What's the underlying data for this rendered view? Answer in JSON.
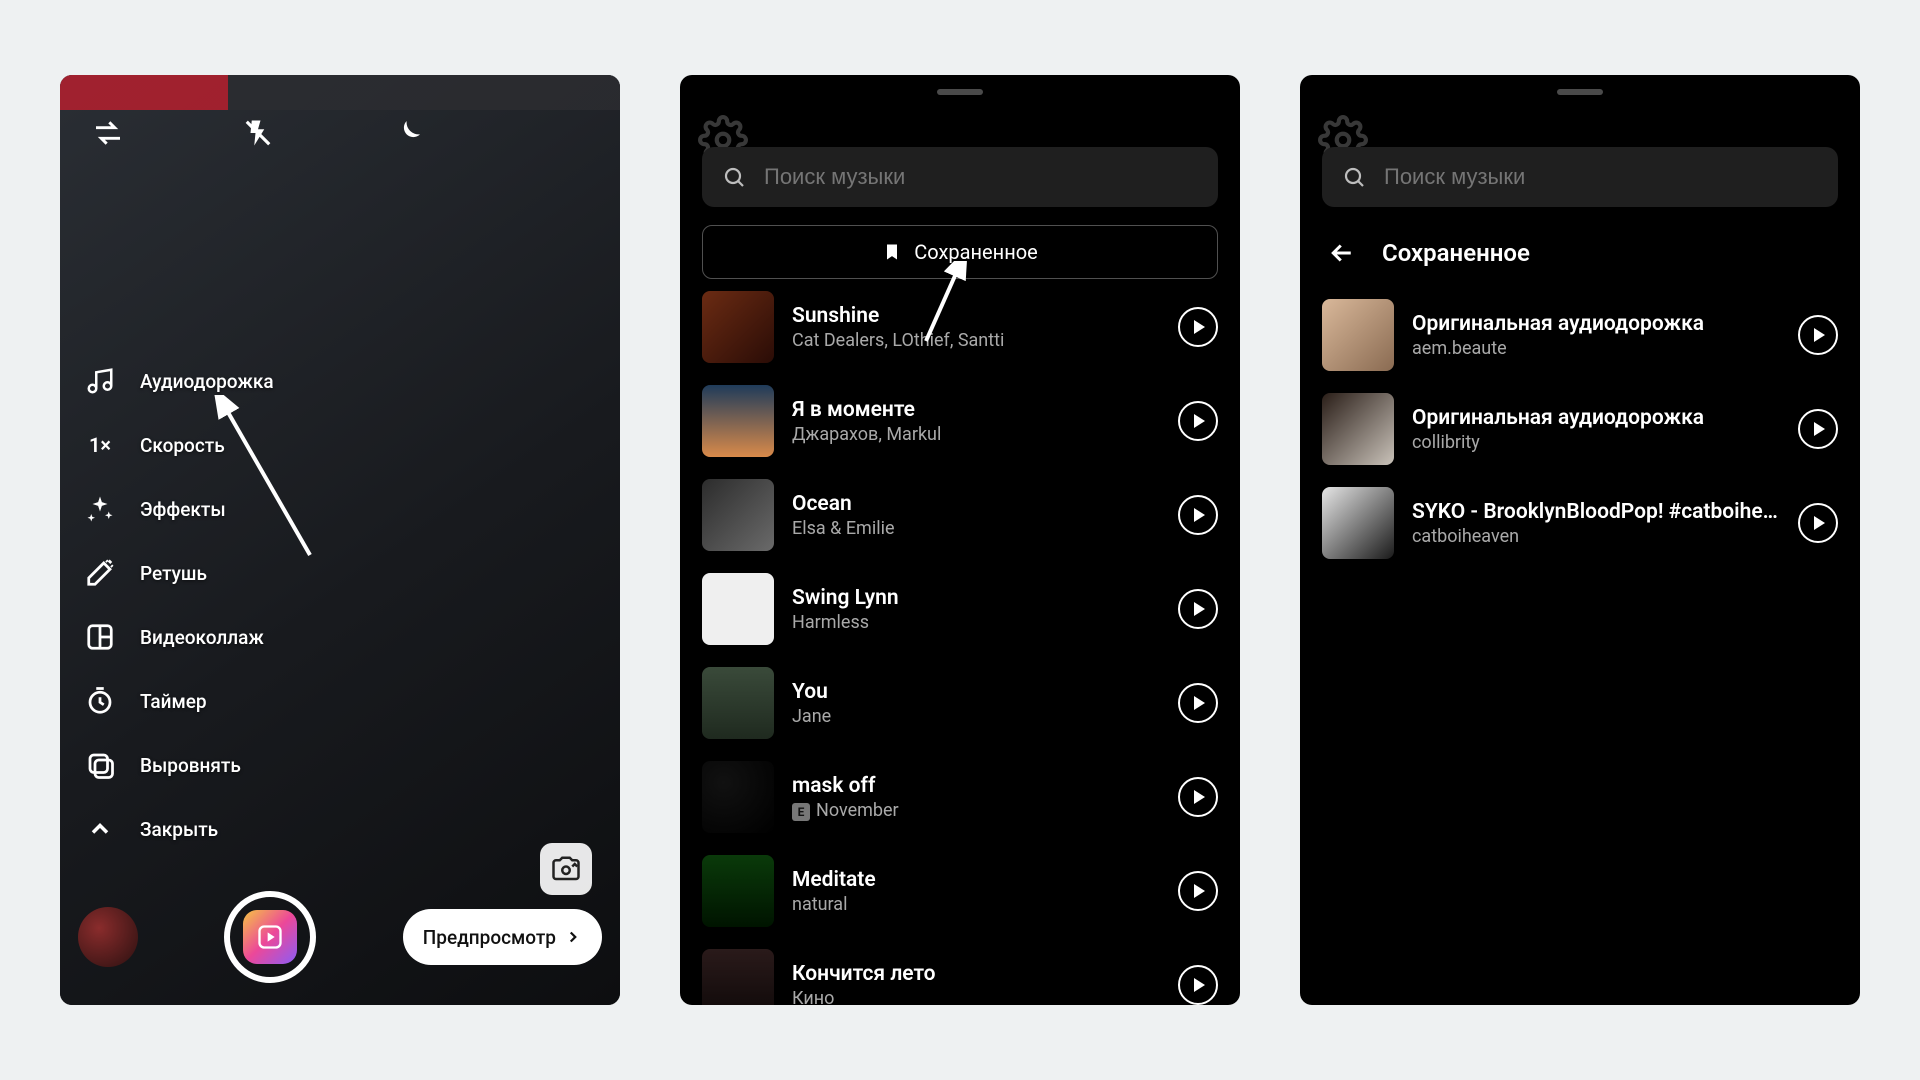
{
  "panel1": {
    "sidebar": [
      {
        "icon": "music-icon",
        "label": "Аудиодорожка"
      },
      {
        "icon": "speed-icon",
        "label": "Скорость",
        "speed": "1×"
      },
      {
        "icon": "sparkle-icon",
        "label": "Эффекты"
      },
      {
        "icon": "wand-icon",
        "label": "Ретушь"
      },
      {
        "icon": "collage-icon",
        "label": "Видеоколлаж"
      },
      {
        "icon": "timer-icon",
        "label": "Таймер"
      },
      {
        "icon": "align-icon",
        "label": "Выровнять"
      },
      {
        "icon": "chevron-up-icon",
        "label": "Закрыть"
      }
    ],
    "preview_label": "Предпросмотр"
  },
  "panel2": {
    "search_placeholder": "Поиск музыки",
    "saved_label": "Сохраненное",
    "tracks": [
      {
        "title": "Sunshine",
        "artist": "Cat Dealers, LOthief, Santti",
        "cover": "cov-a"
      },
      {
        "title": "Я в моменте",
        "artist": "Джарахов, Markul",
        "cover": "cov-b"
      },
      {
        "title": "Ocean",
        "artist": "Elsa & Emilie",
        "cover": "cov-c"
      },
      {
        "title": "Swing Lynn",
        "artist": "Harmless",
        "cover": "cov-d"
      },
      {
        "title": "You",
        "artist": "Jane",
        "cover": "cov-e"
      },
      {
        "title": "mask off",
        "artist": "November",
        "explicit": true,
        "cover": "cov-f"
      },
      {
        "title": "Meditate",
        "artist": "natural",
        "cover": "cov-g"
      },
      {
        "title": "Кончится лето",
        "artist": "Кино",
        "cover": "cov-h"
      }
    ]
  },
  "panel3": {
    "search_placeholder": "Поиск музыки",
    "header_title": "Сохраненное",
    "tracks": [
      {
        "title": "Оригинальная аудиодорожка",
        "artist": "aem.beaute",
        "cover": "cov-i"
      },
      {
        "title": "Оригинальная аудиодорожка",
        "artist": "collibrity",
        "cover": "cov-j"
      },
      {
        "title": "SYKO - BrooklynBloodPop! #catboiheaven",
        "artist": "catboiheaven",
        "cover": "cov-k"
      }
    ]
  }
}
